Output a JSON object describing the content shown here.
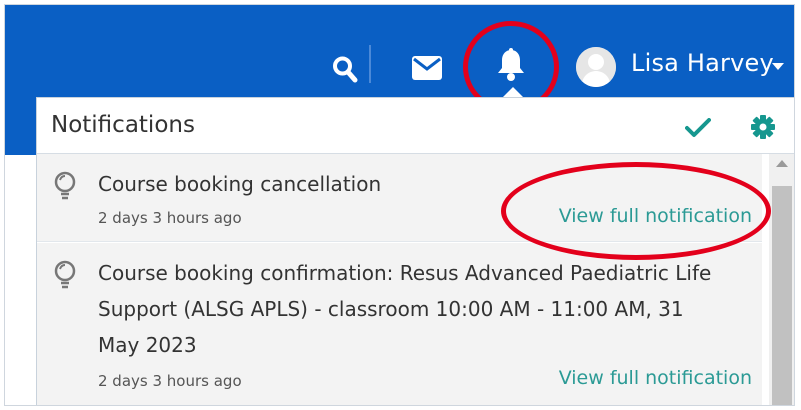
{
  "topbar": {
    "user_name": "Lisa Harvey",
    "icons": [
      "search-icon",
      "envelope-icon",
      "bell-icon"
    ],
    "background_color": "#0a5fc4"
  },
  "notifications": {
    "title": "Notifications",
    "icons": [
      "checkmark-icon",
      "gear-icon"
    ],
    "accent_color": "#16978f",
    "items": [
      {
        "title": "Course booking cancellation",
        "time": "2 days 3 hours ago",
        "link": "View full notification"
      },
      {
        "title": "Course booking confirmation: Resus Advanced Paediatric Life Support (ALSG APLS) - classroom 10:00 AM - 11:00 AM, 31 May 2023",
        "time": "2 days 3 hours ago",
        "link": "View full notification"
      }
    ]
  },
  "annotations": {
    "color": "#e3001b"
  }
}
